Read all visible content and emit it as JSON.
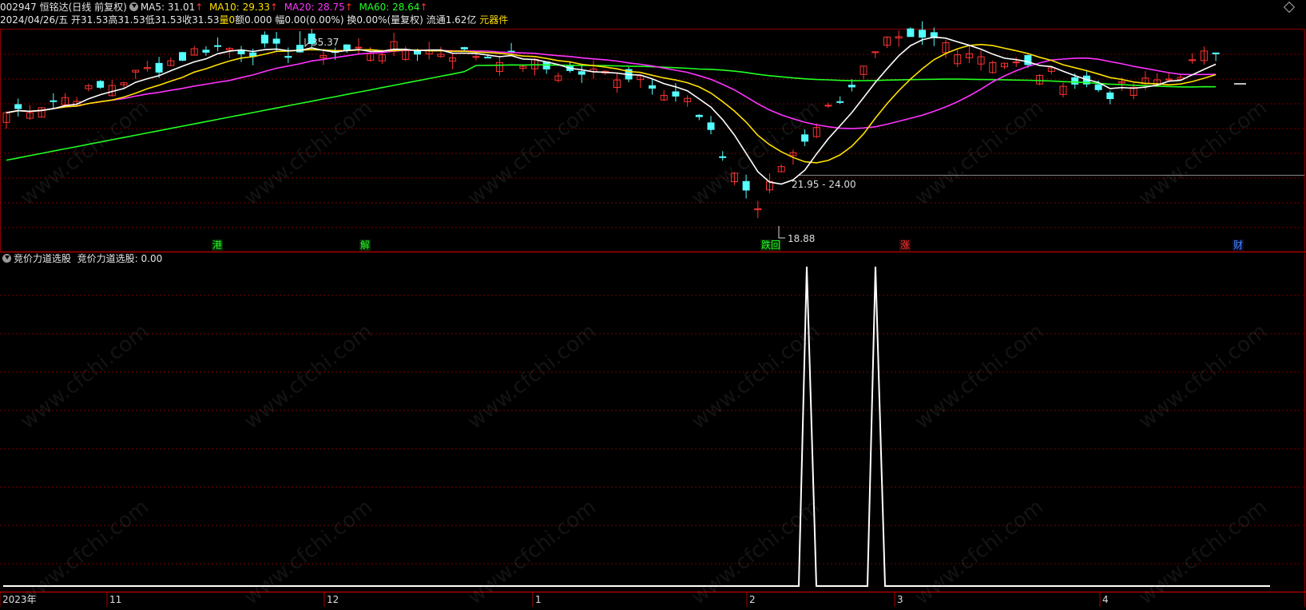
{
  "header": {
    "stock": "002947 恒铭达(日线 前复权)",
    "ma5": "MA5: 31.01",
    "ma10": "MA10: 29.33",
    "ma20": "MA20: 28.75",
    "ma60": "MA60: 28.64",
    "arrow": "↑",
    "date": "2024/04/26/五",
    "open": "开31.53",
    "high": "高31.53",
    "low": "低31.53",
    "close": "收31.53",
    "vol": "量0",
    "amount": "额0.000",
    "change": "幅0.00(0.00%)",
    "turnover": "换0.00%(量复权)",
    "float": "流通1.62亿",
    "sector": "元器件"
  },
  "price_labels": {
    "high": "35.37",
    "low": "18.88",
    "mid": "21.95 - 24.00"
  },
  "event_tags": [
    "港",
    "解",
    "跌回",
    "涨",
    "财"
  ],
  "indicator": {
    "name": "竞价力道选股",
    "value_label": "竞价力道选股: 0.00"
  },
  "x_axis": [
    "2023年",
    "11",
    "12",
    "1",
    "2",
    "3",
    "4"
  ],
  "watermark": "www.cfchi.com",
  "colors": {
    "up": "#ff3333",
    "down": "#54ffff",
    "ma5": "#ffffff",
    "ma10": "#ffe000",
    "ma20": "#ff33ff",
    "ma60": "#22ff22",
    "grid": "#7a0000"
  },
  "chart_data": {
    "type": "line",
    "title": "",
    "x": [
      "2023年",
      "11",
      "12",
      "1",
      "2",
      "3",
      "4"
    ],
    "series": [
      {
        "name": "竞价力道选股",
        "values": [
          0,
          0,
          0,
          0,
          0,
          1,
          0,
          1,
          0,
          0
        ]
      }
    ],
    "notes_price": {
      "high": 35.37,
      "low": 18.88,
      "range_low": 21.95,
      "range_high": 24.0
    },
    "ma": {
      "MA5": 31.01,
      "MA10": 29.33,
      "MA20": 28.75,
      "MA60": 28.64
    }
  }
}
